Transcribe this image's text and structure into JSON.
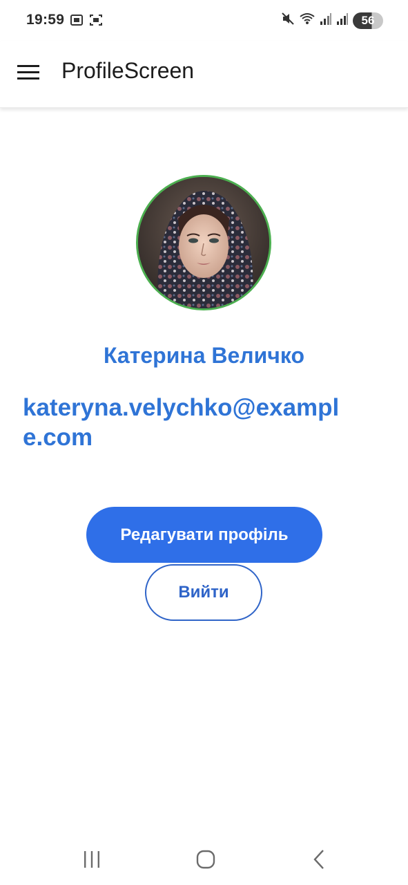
{
  "status_bar": {
    "time": "19:59",
    "battery": "56",
    "left_icons": [
      "screenshot-icon",
      "screen-capture-icon"
    ],
    "right_icons": [
      "mute-icon",
      "wifi-icon",
      "signal-icon",
      "signal-icon-2",
      "battery-icon"
    ]
  },
  "app_bar": {
    "title": "ProfileScreen",
    "menu_icon": "hamburger-menu-icon"
  },
  "profile": {
    "name": "Катерина Величко",
    "email": "kateryna.velychko@example.com"
  },
  "actions": {
    "edit_label": "Редагувати профіль",
    "logout_label": "Вийти"
  },
  "navigation": {
    "recents_icon": "recent-apps-icon",
    "home_icon": "home-icon",
    "back_icon": "back-icon"
  },
  "colors": {
    "accent": "#2f74d6",
    "primary_button": "#2f6fe8",
    "avatar_border": "#4caf50",
    "outline_button": "#2f64c8"
  }
}
